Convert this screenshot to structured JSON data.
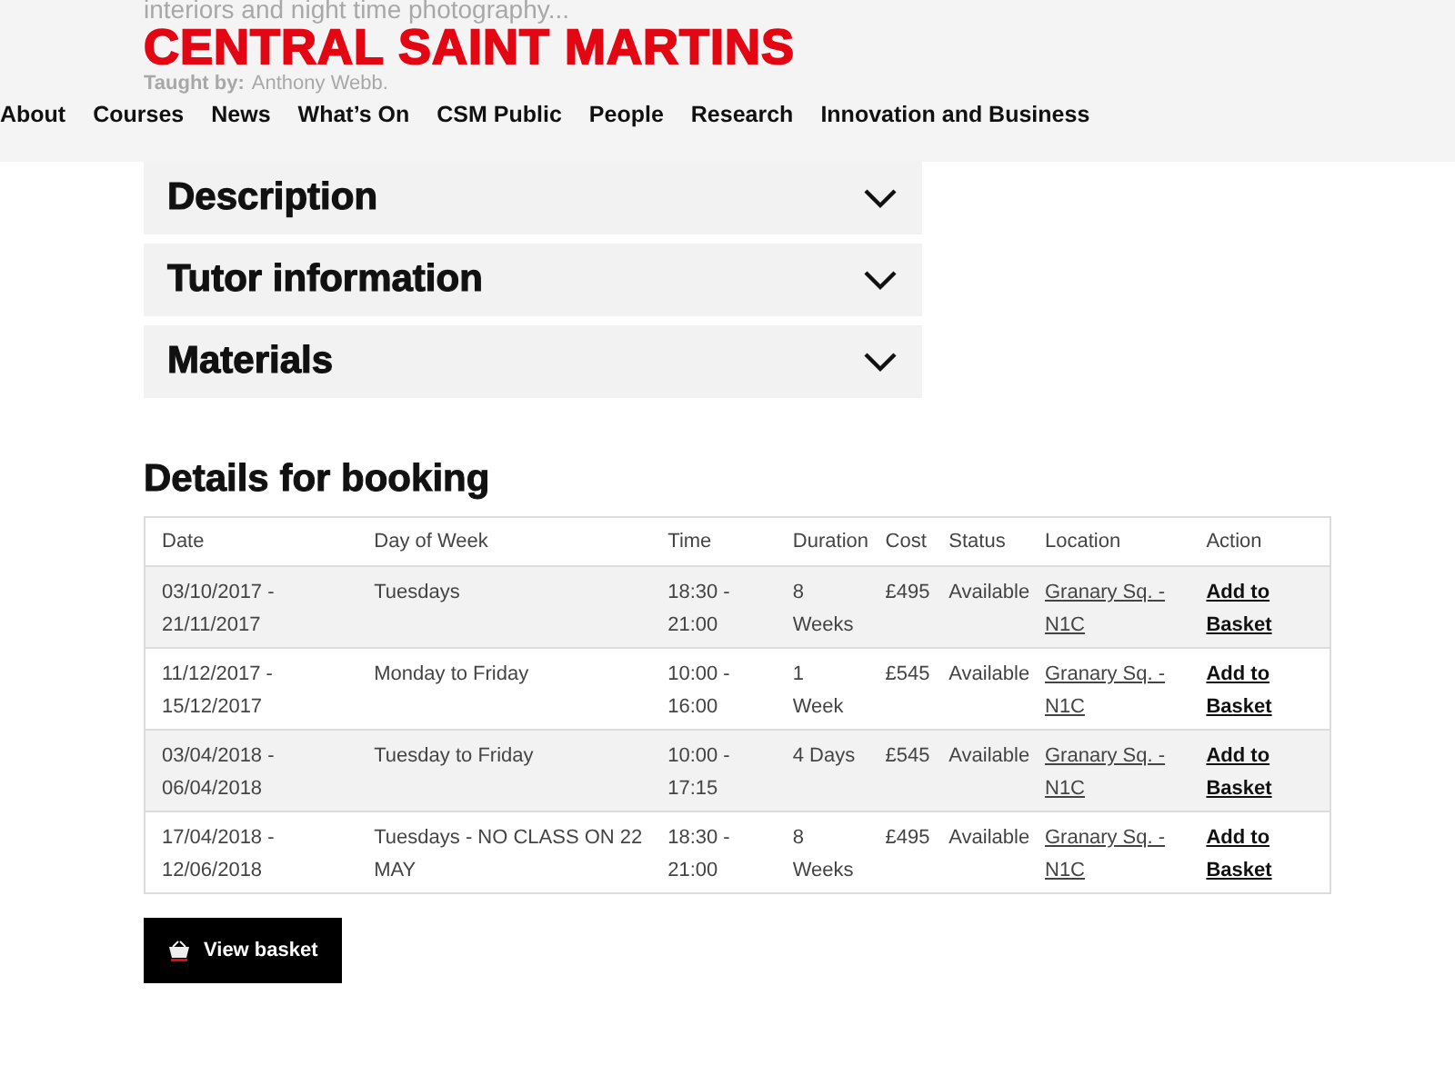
{
  "background_text": {
    "intro_line": "interiors and night time photography...",
    "taught_by_label": "Taught by:",
    "taught_by_name": "Anthony Webb."
  },
  "logo": "CENTRAL SAINT MARTINS",
  "nav": [
    "About",
    "Courses",
    "News",
    "What’s On",
    "CSM Public",
    "People",
    "Research",
    "Innovation and Business"
  ],
  "accordion": [
    {
      "title": "Description",
      "expanded": false
    },
    {
      "title": "Tutor information",
      "expanded": false
    },
    {
      "title": "Materials",
      "expanded": false
    }
  ],
  "booking": {
    "heading": "Details for booking",
    "columns": [
      "Date",
      "Day of Week",
      "Time",
      "Duration",
      "Cost",
      "Status",
      "Location",
      "Action"
    ],
    "rows": [
      {
        "date": "03/10/2017 - 21/11/2017",
        "day": "Tuesdays",
        "time": "18:30 - 21:00",
        "duration": "8 Weeks",
        "cost": "£495",
        "status": "Available",
        "location": "Granary Sq. - N1C",
        "action": "Add to Basket"
      },
      {
        "date": "11/12/2017 - 15/12/2017",
        "day": "Monday to Friday",
        "time": "10:00 - 16:00",
        "duration": "1 Week",
        "cost": "£545",
        "status": "Available",
        "location": "Granary Sq. - N1C",
        "action": "Add to Basket"
      },
      {
        "date": "03/04/2018 - 06/04/2018",
        "day": "Tuesday to Friday",
        "time": "10:00 - 17:15",
        "duration": "4 Days",
        "cost": "£545",
        "status": "Available",
        "location": "Granary Sq. - N1C",
        "action": "Add to Basket"
      },
      {
        "date": "17/04/2018 - 12/06/2018",
        "day": "Tuesdays - NO CLASS ON 22 MAY",
        "time": "18:30 - 21:00",
        "duration": "8 Weeks",
        "cost": "£495",
        "status": "Available",
        "location": "Granary Sq. - N1C",
        "action": "Add to Basket"
      }
    ]
  },
  "view_basket": "View basket"
}
